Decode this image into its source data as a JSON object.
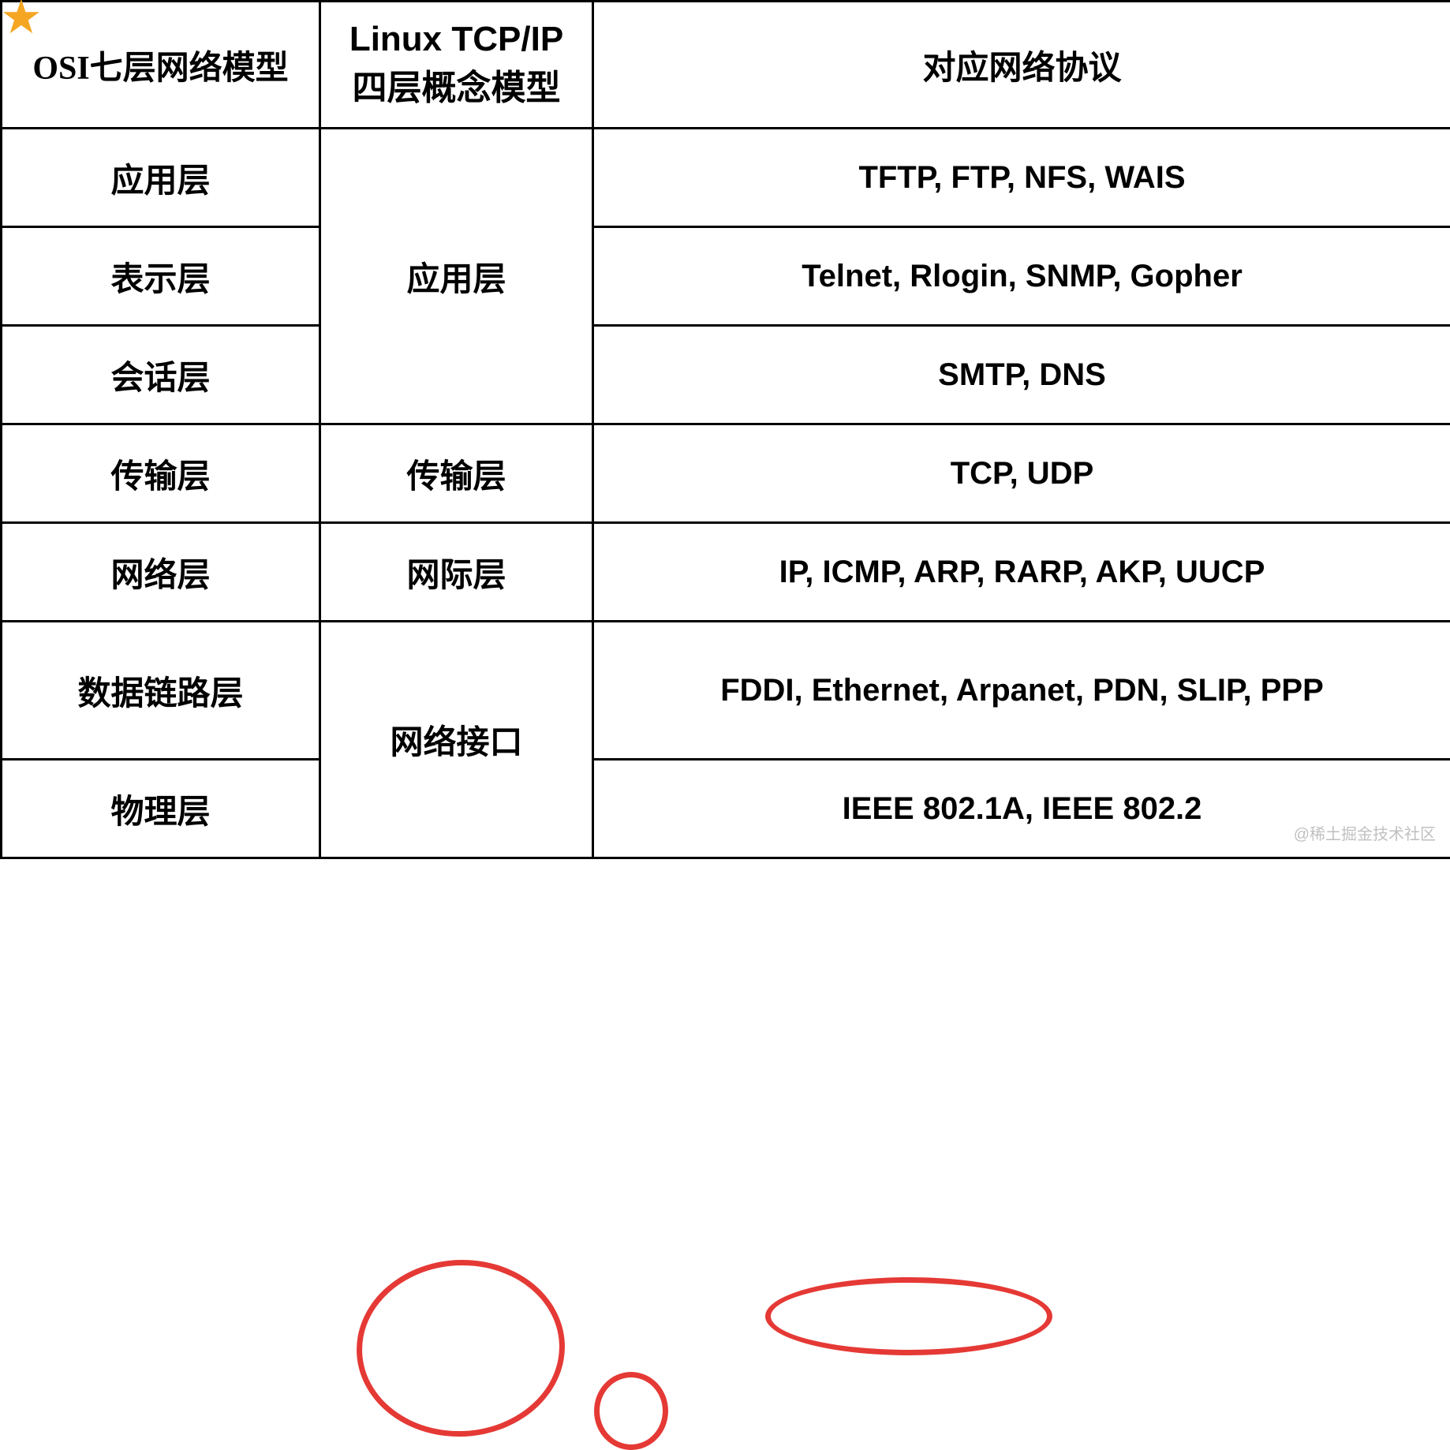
{
  "headers": {
    "col1": "OSI七层网络模型",
    "col2_line1": "Linux TCP/IP",
    "col2_line2": "四层概念模型",
    "col3": "对应网络协议"
  },
  "rows": [
    {
      "osi": "应用层",
      "tcp": "应用层",
      "proto": "TFTP, FTP, NFS, WAIS"
    },
    {
      "osi": "表示层",
      "tcp": "",
      "proto": "Telnet, Rlogin, SNMP, Gopher"
    },
    {
      "osi": "会话层",
      "tcp": "",
      "proto": "SMTP, DNS"
    },
    {
      "osi": "传输层",
      "tcp": "传输层",
      "proto": "TCP, UDP"
    },
    {
      "osi": "网络层",
      "tcp": "网际层",
      "proto": "IP, ICMP, ARP, RARP, AKP, UUCP"
    },
    {
      "osi": "数据链路层",
      "tcp": "网络接口",
      "proto": "FDDI, Ethernet, Arpanet, PDN, SLIP, PPP"
    },
    {
      "osi": "物理层",
      "tcp": "",
      "proto": "IEEE 802.1A, IEEE 802.2"
    }
  ],
  "watermark": "@稀土掘金技术社区",
  "icons": {
    "star": "star-icon"
  }
}
